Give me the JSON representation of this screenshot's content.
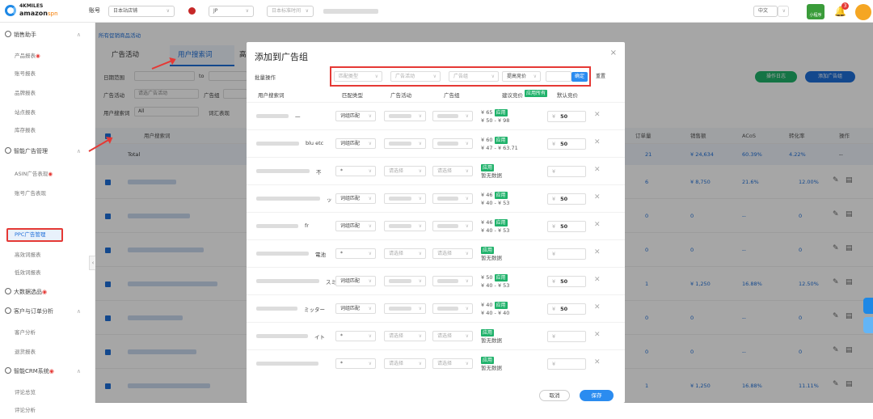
{
  "brand": {
    "line1": "4KMILES",
    "line2": "amazon",
    "line2b": "spn"
  },
  "topbar": {
    "account_label": "账号",
    "account_value": "日本站店铺",
    "country": "JP",
    "timezone": "日本标准时间",
    "lang": "中文",
    "app_label": "小程序",
    "bell_count": "3"
  },
  "sidebar": {
    "groups": [
      {
        "label": "销售助手",
        "children": [
          "产品报表",
          "账号报表",
          "品牌报表",
          "站点报表",
          "库存报表"
        ]
      },
      {
        "label": "智能广告管理",
        "children": [
          "ASIN广告表现",
          "账号广告表现",
          "PPC广告管理",
          "高效词报表",
          "低效词报表"
        ]
      },
      {
        "label": "大数据选品"
      },
      {
        "label": "客户与订单分析",
        "children": [
          "客户分析",
          "退货报表"
        ]
      },
      {
        "label": "智能CRM系统",
        "children": [
          "评论总览",
          "评论分析"
        ]
      }
    ]
  },
  "main": {
    "breadcrumb": "所有促销商品活动",
    "tabs": [
      "广告活动",
      "用户搜索词",
      "高级"
    ],
    "filters": {
      "date_label": "日期范围",
      "to": "to",
      "campaign_label": "广告活动",
      "campaign_ph": "请选广告活动",
      "adgroup_label": "广告组",
      "search_label": "用户搜索词",
      "search_value": "All",
      "keyword_label": "词汇表现"
    },
    "buttons": {
      "report_log": "操作日志",
      "add_group": "添加广告组"
    },
    "columns": [
      "用户搜索词",
      "订单量",
      "销售额",
      "ACoS",
      "转化率",
      "操作"
    ],
    "total_label": "Total",
    "total": {
      "orders": "21",
      "sales": "¥ 24,634",
      "acos": "60.39%",
      "cvr": "4.22%",
      "ops": "--"
    },
    "rows": [
      {
        "orders": "6",
        "sales": "¥ 8,750",
        "acos": "21.6%",
        "cvr": "12.00%"
      },
      {
        "orders": "0",
        "sales": "0",
        "acos": "--",
        "cvr": "0"
      },
      {
        "orders": "0",
        "sales": "0",
        "acos": "--",
        "cvr": "0"
      },
      {
        "orders": "1",
        "sales": "¥ 1,250",
        "acos": "16.88%",
        "cvr": "12.50%"
      },
      {
        "orders": "0",
        "sales": "0",
        "acos": "--",
        "cvr": "0"
      },
      {
        "orders": "0",
        "sales": "0",
        "acos": "--",
        "cvr": "0"
      },
      {
        "orders": "1",
        "sales": "¥ 1,250",
        "acos": "16.88%",
        "cvr": "11.11%"
      }
    ]
  },
  "modal": {
    "title": "添加到广告组",
    "close": "×",
    "batch_label": "批量操作",
    "batch": {
      "match_ph": "匹配类型",
      "campaign_ph": "广告活动",
      "adgroup_ph": "广告组",
      "bid_ph": "提高竞价",
      "confirm": "确定",
      "reset": "重置"
    },
    "headers": {
      "term": "用户搜索词",
      "match": "匹配类型",
      "campaign": "广告活动",
      "adgroup": "广告组",
      "suggest": "建议竞价",
      "apply_all": "应用所有",
      "bid": "默认竞价"
    },
    "apply": "应用",
    "rows": [
      {
        "term": "一",
        "match": "词组匹配",
        "sug1": "¥ 65",
        "sug2": "¥ 50 - ¥ 98",
        "bid": "50",
        "selected": true
      },
      {
        "term": "blu etc",
        "match": "词组匹配",
        "sug1": "¥ 60",
        "sug2": "¥ 47 - ¥ 63.71",
        "bid": "50",
        "selected": true
      },
      {
        "term": "不",
        "match": "*",
        "sug1": "",
        "sug2": "暂无数据",
        "bid": "",
        "selected": false
      },
      {
        "term": "ッ",
        "match": "词组匹配",
        "sug1": "¥ 46",
        "sug2": "¥ 40 - ¥ 53",
        "bid": "50",
        "selected": true
      },
      {
        "term": "fr",
        "match": "词组匹配",
        "sug1": "¥ 46",
        "sug2": "¥ 40 - ¥ 53",
        "bid": "50",
        "selected": true
      },
      {
        "term": "電池",
        "match": "*",
        "sug1": "",
        "sug2": "暂无数据",
        "bid": "",
        "selected": false
      },
      {
        "term": "スミッター",
        "match": "词组匹配",
        "sug1": "¥ 50",
        "sug2": "¥ 40 - ¥ 53",
        "bid": "50",
        "selected": true
      },
      {
        "term": "ミッター",
        "match": "词组匹配",
        "sug1": "¥ 40",
        "sug2": "¥ 40 - ¥ 40",
        "bid": "50",
        "selected": true
      },
      {
        "term": "イト",
        "match": "*",
        "sug1": "",
        "sug2": "暂无数据",
        "bid": "",
        "selected": false
      },
      {
        "term": "",
        "match": "*",
        "sug1": "",
        "sug2": "暂无数据",
        "bid": "",
        "selected": false
      }
    ],
    "select_ph": "请选择",
    "yen": "¥",
    "cancel": "取消",
    "save": "保存"
  }
}
